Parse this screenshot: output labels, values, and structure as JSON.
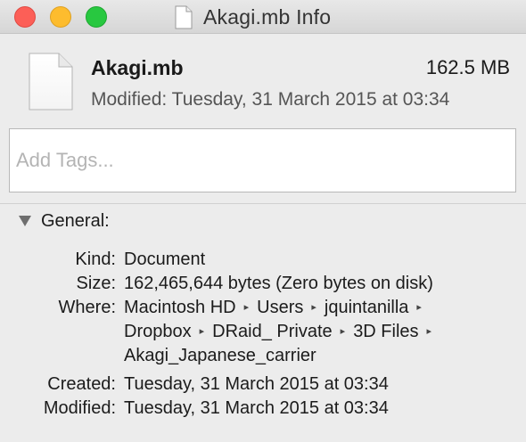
{
  "window": {
    "title": "Akagi.mb Info",
    "title_icon": "document-icon"
  },
  "header": {
    "file_name": "Akagi.mb",
    "file_size": "162.5 MB",
    "modified_line": "Modified: Tuesday, 31 March 2015 at 03:34",
    "icon": "document-icon"
  },
  "tags": {
    "placeholder": "Add Tags...",
    "value": ""
  },
  "general": {
    "title": "General:",
    "expanded": true,
    "rows": [
      {
        "label": "Kind:",
        "value": "Document"
      },
      {
        "label": "Size:",
        "value": "162,465,644 bytes (Zero bytes on disk)"
      },
      {
        "label": "Where:",
        "path_lines": [
          [
            "Macintosh HD",
            "Users",
            "jquintanilla",
            ""
          ],
          [
            "Dropbox",
            "DRaid_ Private",
            "3D Files",
            ""
          ],
          [
            "Akagi_Japanese_carrier"
          ]
        ]
      },
      {
        "label": "Created:",
        "value": "Tuesday, 31 March 2015 at 03:34"
      },
      {
        "label": "Modified:",
        "value": "Tuesday, 31 March 2015 at 03:34"
      }
    ]
  },
  "colors": {
    "close": "#fc5f57",
    "minimize": "#fdbc2e",
    "zoom": "#28c840",
    "window_bg": "#ececec"
  }
}
